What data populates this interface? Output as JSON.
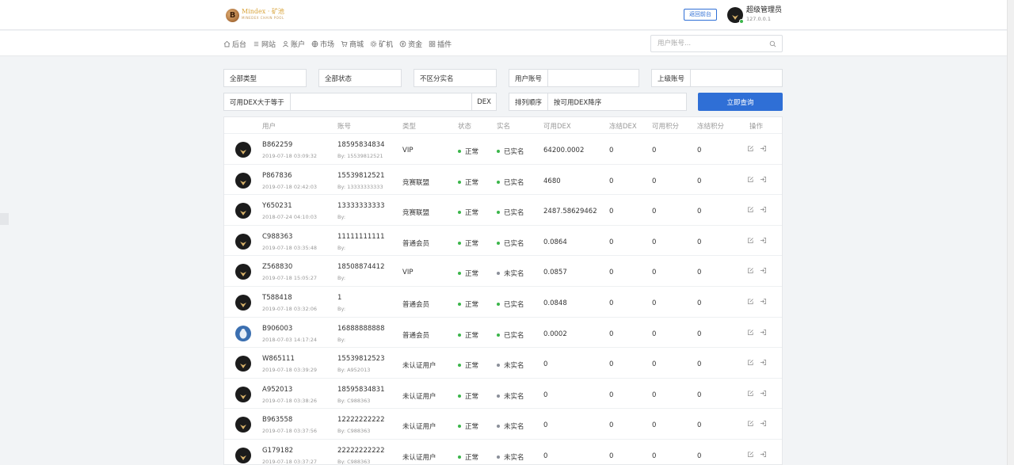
{
  "header": {
    "logo_text": "Mindex · 矿池",
    "logo_sub": "MINEDEX CHAIN POOL",
    "logo_letter": "B",
    "back_button": "返回前台",
    "user_name": "超级管理员",
    "user_ip": "127.0.0.1"
  },
  "nav": {
    "items": [
      {
        "label": "后台",
        "icon": "home-icon"
      },
      {
        "label": "网站",
        "icon": "list-icon"
      },
      {
        "label": "账户",
        "icon": "user-icon"
      },
      {
        "label": "市场",
        "icon": "globe-icon"
      },
      {
        "label": "商城",
        "icon": "cart-icon"
      },
      {
        "label": "矿机",
        "icon": "gear-icon"
      },
      {
        "label": "资金",
        "icon": "coin-icon"
      },
      {
        "label": "插件",
        "icon": "grid-icon"
      }
    ],
    "search_placeholder": "用户账号..."
  },
  "filters": {
    "type": "全部类型",
    "status": "全部状态",
    "realname": "不区分实名",
    "user_account_label": "用户账号",
    "user_account_value": "",
    "parent_account_label": "上级账号",
    "parent_account_value": "",
    "dex_label": "可用DEX大于等于",
    "dex_value": "",
    "dex_unit": "DEX",
    "sort_label": "排列顺序",
    "sort_value": "按可用DEX降序",
    "query_button": "立即查询"
  },
  "table": {
    "columns": [
      "用户",
      "账号",
      "类型",
      "状态",
      "实名",
      "可用DEX",
      "冻结DEX",
      "可用积分",
      "冻结积分",
      "操作"
    ],
    "rows": [
      {
        "uid": "B862259",
        "time": "2019-07-18 03:09:32",
        "account": "18595834834",
        "by": "By: 15539812521",
        "type": "VIP",
        "status": "正常",
        "realname": "已实名",
        "verified": true,
        "dex": "64200.0002",
        "fdex": "0",
        "points": "0",
        "fpoints": "0",
        "avatar": "eagle"
      },
      {
        "uid": "P867836",
        "time": "2019-07-18 02:42:03",
        "account": "15539812521",
        "by": "By: 13333333333",
        "type": "竞赛联盟",
        "status": "正常",
        "realname": "已实名",
        "verified": true,
        "dex": "4680",
        "fdex": "0",
        "points": "0",
        "fpoints": "0",
        "avatar": "eagle"
      },
      {
        "uid": "Y650231",
        "time": "2018-07-24 04:10:03",
        "account": "13333333333",
        "by": "By:",
        "type": "竞赛联盟",
        "status": "正常",
        "realname": "已实名",
        "verified": true,
        "dex": "2487.58629462",
        "fdex": "0",
        "points": "0",
        "fpoints": "0",
        "avatar": "eagle"
      },
      {
        "uid": "C988363",
        "time": "2019-07-18 03:35:48",
        "account": "11111111111",
        "by": "By:",
        "type": "普通会员",
        "status": "正常",
        "realname": "已实名",
        "verified": true,
        "dex": "0.0864",
        "fdex": "0",
        "points": "0",
        "fpoints": "0",
        "avatar": "eagle"
      },
      {
        "uid": "Z568830",
        "time": "2019-07-18 15:05:27",
        "account": "18508874412",
        "by": "By:",
        "type": "VIP",
        "status": "正常",
        "realname": "未实名",
        "verified": false,
        "dex": "0.0857",
        "fdex": "0",
        "points": "0",
        "fpoints": "0",
        "avatar": "eagle"
      },
      {
        "uid": "T588418",
        "time": "2019-07-18 03:32:06",
        "account": "1",
        "by": "By:",
        "type": "普通会员",
        "status": "正常",
        "realname": "已实名",
        "verified": true,
        "dex": "0.0848",
        "fdex": "0",
        "points": "0",
        "fpoints": "0",
        "avatar": "eagle"
      },
      {
        "uid": "B906003",
        "time": "2018-07-03 14:17:24",
        "account": "16888888888",
        "by": "By:",
        "type": "普通会员",
        "status": "正常",
        "realname": "已实名",
        "verified": true,
        "dex": "0.0002",
        "fdex": "0",
        "points": "0",
        "fpoints": "0",
        "avatar": "bird"
      },
      {
        "uid": "W865111",
        "time": "2019-07-18 03:39:29",
        "account": "15539812523",
        "by": "By: A952013",
        "type": "未认证用户",
        "status": "正常",
        "realname": "未实名",
        "verified": false,
        "dex": "0",
        "fdex": "0",
        "points": "0",
        "fpoints": "0",
        "avatar": "eagle"
      },
      {
        "uid": "A952013",
        "time": "2019-07-18 03:38:26",
        "account": "18595834831",
        "by": "By: C988363",
        "type": "未认证用户",
        "status": "正常",
        "realname": "未实名",
        "verified": false,
        "dex": "0",
        "fdex": "0",
        "points": "0",
        "fpoints": "0",
        "avatar": "eagle"
      },
      {
        "uid": "B963558",
        "time": "2019-07-18 03:37:56",
        "account": "12222222222",
        "by": "By: C988363",
        "type": "未认证用户",
        "status": "正常",
        "realname": "未实名",
        "verified": false,
        "dex": "0",
        "fdex": "0",
        "points": "0",
        "fpoints": "0",
        "avatar": "eagle"
      },
      {
        "uid": "G179182",
        "time": "2019-07-18 03:37:27",
        "account": "22222222222",
        "by": "By: C988363",
        "type": "未认证用户",
        "status": "正常",
        "realname": "未实名",
        "verified": false,
        "dex": "0",
        "fdex": "0",
        "points": "0",
        "fpoints": "0",
        "avatar": "eagle"
      }
    ]
  },
  "colors": {
    "primary": "#2f6fd6",
    "ok": "#3bb54a",
    "muted": "#8a8f99"
  }
}
